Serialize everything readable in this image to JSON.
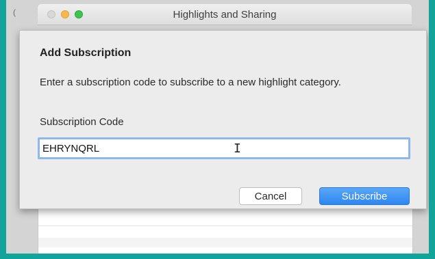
{
  "window": {
    "title": "Highlights and Sharing",
    "background_edge_glyph": "("
  },
  "dialog": {
    "title": "Add Subscription",
    "description": "Enter a subscription code to subscribe to a new highlight category.",
    "field_label": "Subscription Code",
    "code_value": "EHRYNQRL",
    "cancel_label": "Cancel",
    "subscribe_label": "Subscribe"
  },
  "colors": {
    "frame_teal": "#12a39a",
    "primary_button": "#2e86ef",
    "input_focus_ring": "#8fb8ea",
    "traffic_minimize": "#f6b84f",
    "traffic_zoom": "#3dc552"
  },
  "icons": {
    "close": "close-icon",
    "minimize": "minimize-icon",
    "zoom": "zoom-icon",
    "text_cursor": "i-beam-cursor-icon"
  }
}
